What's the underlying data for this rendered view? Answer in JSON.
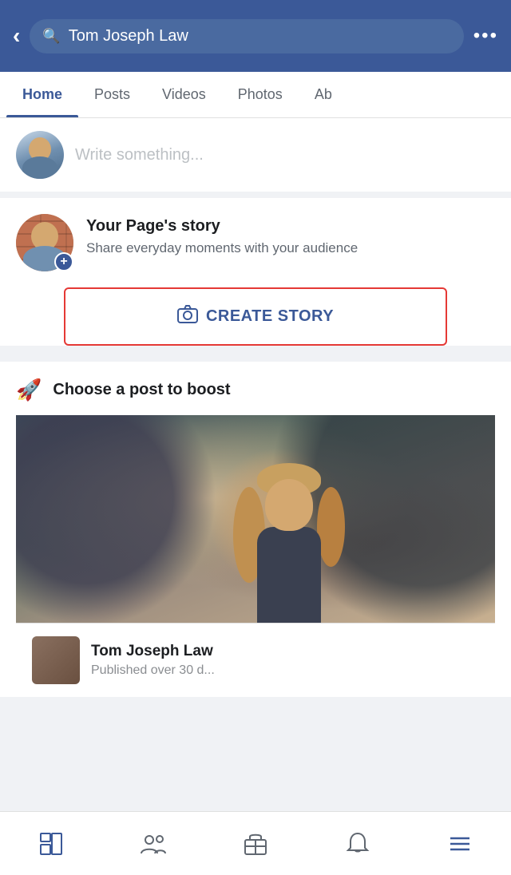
{
  "header": {
    "title": "Tom Joseph Law",
    "back_label": "‹",
    "more_label": "•••",
    "search_placeholder": "Tom Joseph Law"
  },
  "nav_tabs": {
    "items": [
      {
        "label": "Home",
        "active": true
      },
      {
        "label": "Posts",
        "active": false
      },
      {
        "label": "Videos",
        "active": false
      },
      {
        "label": "Photos",
        "active": false
      },
      {
        "label": "Ab",
        "active": false
      }
    ]
  },
  "post_box": {
    "placeholder": "Write something..."
  },
  "story_section": {
    "title": "Your Page's story",
    "subtitle": "Share everyday moments with your audience",
    "create_button": "CREATE STORY"
  },
  "boost_section": {
    "title": "Choose a post to boost"
  },
  "post_preview": {
    "name": "Tom Joseph Law",
    "date": "Published over 30 d..."
  },
  "bottom_nav": {
    "items": [
      {
        "name": "home-nav",
        "icon": "home"
      },
      {
        "name": "friends-nav",
        "icon": "friends"
      },
      {
        "name": "marketplace-nav",
        "icon": "marketplace"
      },
      {
        "name": "notifications-nav",
        "icon": "bell"
      },
      {
        "name": "menu-nav",
        "icon": "menu"
      }
    ]
  }
}
